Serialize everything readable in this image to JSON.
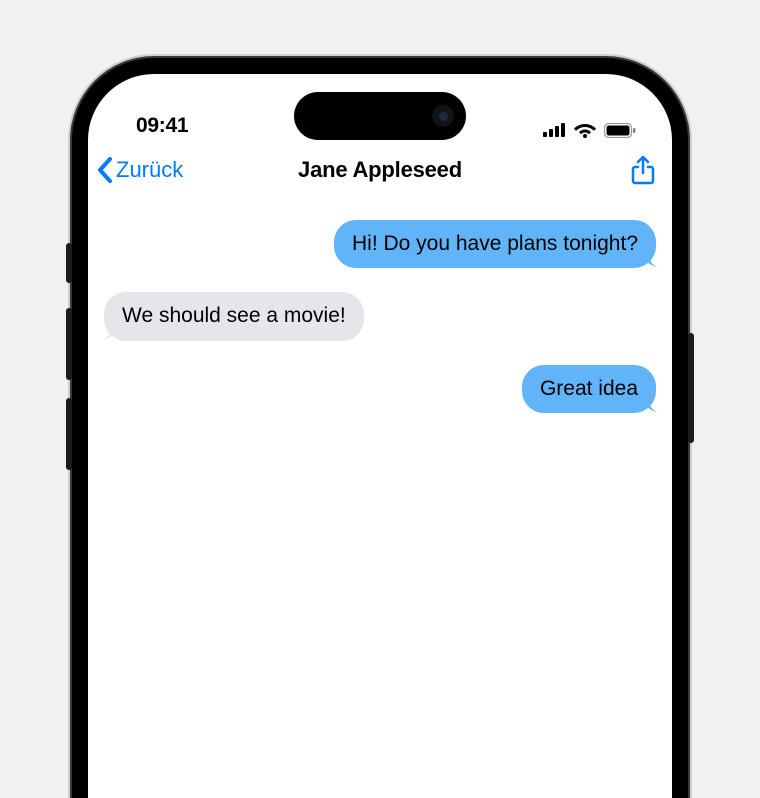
{
  "status": {
    "time": "09:41"
  },
  "nav": {
    "back_label": "Zurück",
    "title": "Jane Appleseed"
  },
  "messages": [
    {
      "direction": "sent",
      "text": "Hi! Do you have plans tonight?"
    },
    {
      "direction": "received",
      "text": "We should see a movie!"
    },
    {
      "direction": "sent",
      "text": "Great idea"
    }
  ],
  "colors": {
    "accent": "#007aff",
    "sent_bubble": "#62b4f9",
    "received_bubble": "#e5e5ea"
  }
}
